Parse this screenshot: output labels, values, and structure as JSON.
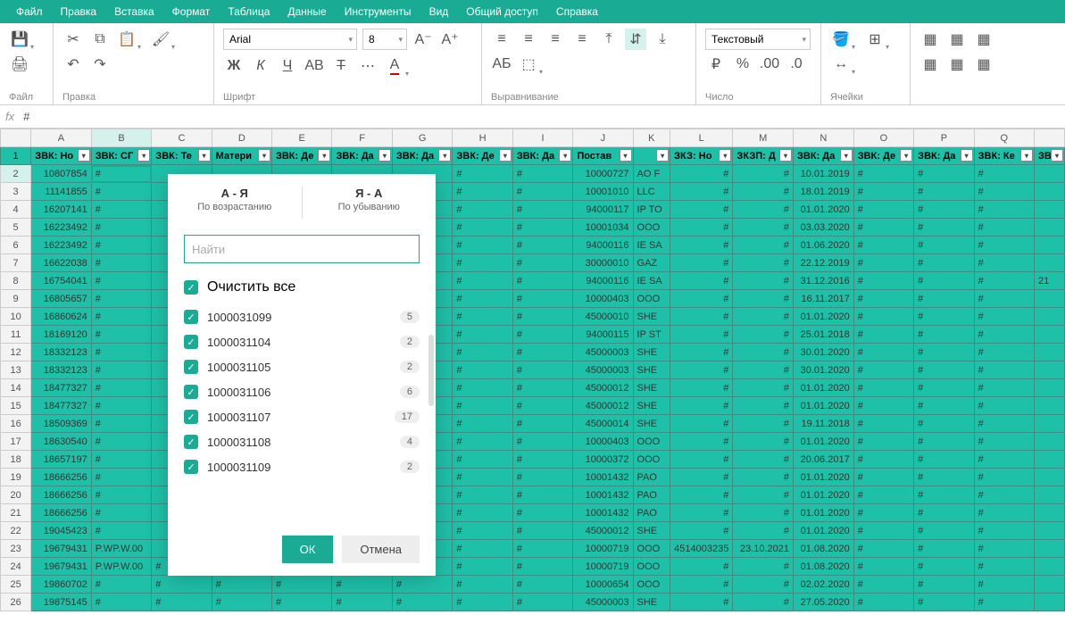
{
  "menu": {
    "items": [
      "Файл",
      "Правка",
      "Вставка",
      "Формат",
      "Таблица",
      "Данные",
      "Инструменты",
      "Вид",
      "Общий доступ",
      "Справка"
    ]
  },
  "ribbon": {
    "groups": {
      "file": "Файл",
      "edit": "Правка",
      "font": "Шрифт",
      "align": "Выравнивание",
      "number": "Число",
      "cells": "Ячейки"
    },
    "font_name": "Arial",
    "font_size": "8",
    "number_format": "Текстовый"
  },
  "formula": {
    "fx": "fx",
    "value": "#"
  },
  "columns": [
    "A",
    "B",
    "C",
    "D",
    "E",
    "F",
    "G",
    "H",
    "I",
    "J",
    "K",
    "L",
    "M",
    "N",
    "O",
    "P",
    "Q",
    ""
  ],
  "headers": [
    "ЗВК: Но",
    "ЗВК: СГ",
    "ЗВК: Те",
    "Матери",
    "ЗВК: Де",
    "ЗВК: Да",
    "ЗВК: Да",
    "ЗВК: Де",
    "ЗВК: Да",
    "Постав",
    "",
    "ЗКЗ: Но",
    "ЗКЗП: Д",
    "ЗВК: Да",
    "ЗВК: Де",
    "ЗВК: Да",
    "ЗВК: Ке",
    "ЗВ"
  ],
  "rows": [
    {
      "n": 1
    },
    {
      "n": 2,
      "A": "10807854",
      "B": "#",
      "H": "#",
      "I": "#",
      "J": "10000727",
      "K": "AO F",
      "L": "#",
      "M": "#",
      "N": "10.01.2019",
      "O": "#",
      "P": "#",
      "Q": "#",
      "R": ""
    },
    {
      "n": 3,
      "A": "11141855",
      "B": "#",
      "H": "#",
      "I": "#",
      "J": "10001010",
      "K": "LLC",
      "L": "#",
      "M": "#",
      "N": "18.01.2019",
      "O": "#",
      "P": "#",
      "Q": "#",
      "R": ""
    },
    {
      "n": 4,
      "A": "16207141",
      "B": "#",
      "H": "#",
      "I": "#",
      "J": "94000117",
      "K": "IP TO",
      "L": "#",
      "M": "#",
      "N": "01.01.2020",
      "O": "#",
      "P": "#",
      "Q": "#",
      "R": ""
    },
    {
      "n": 5,
      "A": "16223492",
      "B": "#",
      "H": "#",
      "I": "#",
      "J": "10001034",
      "K": "OOO",
      "L": "#",
      "M": "#",
      "N": "03.03.2020",
      "O": "#",
      "P": "#",
      "Q": "#",
      "R": ""
    },
    {
      "n": 6,
      "A": "16223492",
      "B": "#",
      "H": "#",
      "I": "#",
      "J": "94000116",
      "K": "IE SA",
      "L": "#",
      "M": "#",
      "N": "01.06.2020",
      "O": "#",
      "P": "#",
      "Q": "#",
      "R": ""
    },
    {
      "n": 7,
      "A": "16622038",
      "B": "#",
      "H": "#",
      "I": "#",
      "J": "30000010",
      "K": "GAZ",
      "L": "#",
      "M": "#",
      "N": "22.12.2019",
      "O": "#",
      "P": "#",
      "Q": "#",
      "R": ""
    },
    {
      "n": 8,
      "A": "16754041",
      "B": "#",
      "H": "#",
      "I": "#",
      "J": "94000116",
      "K": "IE SA",
      "L": "#",
      "M": "#",
      "N": "31.12.2016",
      "O": "#",
      "P": "#",
      "Q": "#",
      "R": "21"
    },
    {
      "n": 9,
      "A": "16805657",
      "B": "#",
      "H": "#",
      "I": "#",
      "J": "10000403",
      "K": "OOO",
      "L": "#",
      "M": "#",
      "N": "16.11.2017",
      "O": "#",
      "P": "#",
      "Q": "#",
      "R": ""
    },
    {
      "n": 10,
      "A": "16860624",
      "B": "#",
      "H": "#",
      "I": "#",
      "J": "45000010",
      "K": "SHE",
      "L": "#",
      "M": "#",
      "N": "01.01.2020",
      "O": "#",
      "P": "#",
      "Q": "#",
      "R": ""
    },
    {
      "n": 11,
      "A": "18169120",
      "B": "#",
      "H": "#",
      "I": "#",
      "J": "94000115",
      "K": "IP ST",
      "L": "#",
      "M": "#",
      "N": "25.01.2018",
      "O": "#",
      "P": "#",
      "Q": "#",
      "R": ""
    },
    {
      "n": 12,
      "A": "18332123",
      "B": "#",
      "H": "#",
      "I": "#",
      "J": "45000003",
      "K": "SHE",
      "L": "#",
      "M": "#",
      "N": "30.01.2020",
      "O": "#",
      "P": "#",
      "Q": "#",
      "R": ""
    },
    {
      "n": 13,
      "A": "18332123",
      "B": "#",
      "H": "#",
      "I": "#",
      "J": "45000003",
      "K": "SHE",
      "L": "#",
      "M": "#",
      "N": "30.01.2020",
      "O": "#",
      "P": "#",
      "Q": "#",
      "R": ""
    },
    {
      "n": 14,
      "A": "18477327",
      "B": "#",
      "H": "#",
      "I": "#",
      "J": "45000012",
      "K": "SHE",
      "L": "#",
      "M": "#",
      "N": "01.01.2020",
      "O": "#",
      "P": "#",
      "Q": "#",
      "R": ""
    },
    {
      "n": 15,
      "A": "18477327",
      "B": "#",
      "H": "#",
      "I": "#",
      "J": "45000012",
      "K": "SHE",
      "L": "#",
      "M": "#",
      "N": "01.01.2020",
      "O": "#",
      "P": "#",
      "Q": "#",
      "R": ""
    },
    {
      "n": 16,
      "A": "18509369",
      "B": "#",
      "H": "#",
      "I": "#",
      "J": "45000014",
      "K": "SHE",
      "L": "#",
      "M": "#",
      "N": "19.11.2018",
      "O": "#",
      "P": "#",
      "Q": "#",
      "R": ""
    },
    {
      "n": 17,
      "A": "18630540",
      "B": "#",
      "H": "#",
      "I": "#",
      "J": "10000403",
      "K": "OOO",
      "L": "#",
      "M": "#",
      "N": "01.01.2020",
      "O": "#",
      "P": "#",
      "Q": "#",
      "R": ""
    },
    {
      "n": 18,
      "A": "18657197",
      "B": "#",
      "H": "#",
      "I": "#",
      "J": "10000372",
      "K": "OOO",
      "L": "#",
      "M": "#",
      "N": "20.06.2017",
      "O": "#",
      "P": "#",
      "Q": "#",
      "R": ""
    },
    {
      "n": 19,
      "A": "18666256",
      "B": "#",
      "H": "#",
      "I": "#",
      "J": "10001432",
      "K": "PAO",
      "L": "#",
      "M": "#",
      "N": "01.01.2020",
      "O": "#",
      "P": "#",
      "Q": "#",
      "R": ""
    },
    {
      "n": 20,
      "A": "18666256",
      "B": "#",
      "H": "#",
      "I": "#",
      "J": "10001432",
      "K": "PAO",
      "L": "#",
      "M": "#",
      "N": "01.01.2020",
      "O": "#",
      "P": "#",
      "Q": "#",
      "R": ""
    },
    {
      "n": 21,
      "A": "18666256",
      "B": "#",
      "H": "#",
      "I": "#",
      "J": "10001432",
      "K": "PAO",
      "L": "#",
      "M": "#",
      "N": "01.01.2020",
      "O": "#",
      "P": "#",
      "Q": "#",
      "R": ""
    },
    {
      "n": 22,
      "A": "19045423",
      "B": "#",
      "H": "#",
      "I": "#",
      "J": "45000012",
      "K": "SHE",
      "L": "#",
      "M": "#",
      "N": "01.01.2020",
      "O": "#",
      "P": "#",
      "Q": "#",
      "R": ""
    },
    {
      "n": 23,
      "A": "19679431",
      "B": "P.WP.W.00",
      "H": "#",
      "I": "#",
      "J": "10000719",
      "K": "OOO",
      "L": "4514003235",
      "M": "23.10.2021",
      "N": "01.08.2020",
      "O": "#",
      "P": "#",
      "Q": "#",
      "R": ""
    },
    {
      "n": 24,
      "A": "19679431",
      "B": "P.WP.W.00",
      "C": "#",
      "D": "#",
      "E": "#",
      "F": "#",
      "G": "#",
      "H": "#",
      "I": "#",
      "J": "10000719",
      "K": "OOO",
      "L": "#",
      "M": "#",
      "N": "01.08.2020",
      "O": "#",
      "P": "#",
      "Q": "#",
      "R": ""
    },
    {
      "n": 25,
      "A": "19860702",
      "B": "#",
      "C": "#",
      "D": "#",
      "E": "#",
      "F": "#",
      "G": "#",
      "H": "#",
      "I": "#",
      "J": "10000654",
      "K": "OOO",
      "L": "#",
      "M": "#",
      "N": "02.02.2020",
      "O": "#",
      "P": "#",
      "Q": "#",
      "R": ""
    },
    {
      "n": 26,
      "A": "19875145",
      "B": "#",
      "C": "#",
      "D": "#",
      "E": "#",
      "F": "#",
      "G": "#",
      "H": "#",
      "I": "#",
      "J": "45000003",
      "K": "SHE",
      "L": "#",
      "M": "#",
      "N": "27.05.2020",
      "O": "#",
      "P": "#",
      "Q": "#",
      "R": ""
    }
  ],
  "popup": {
    "sort_asc_main": "А - Я",
    "sort_asc_sub": "По возрастанию",
    "sort_desc_main": "Я - А",
    "sort_desc_sub": "По убыванию",
    "search_placeholder": "Найти",
    "clear_all": "Очистить все",
    "items": [
      {
        "label": "1000031099",
        "count": "5"
      },
      {
        "label": "1000031104",
        "count": "2"
      },
      {
        "label": "1000031105",
        "count": "2"
      },
      {
        "label": "1000031106",
        "count": "6"
      },
      {
        "label": "1000031107",
        "count": "17"
      },
      {
        "label": "1000031108",
        "count": "4"
      },
      {
        "label": "1000031109",
        "count": "2"
      }
    ],
    "ok": "ОК",
    "cancel": "Отмена"
  }
}
